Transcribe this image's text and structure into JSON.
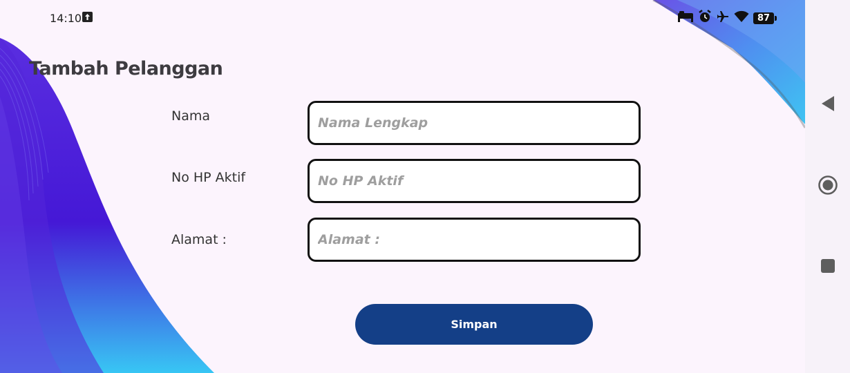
{
  "status_bar": {
    "time": "14:10",
    "upload_icon": "upload-arrow-icon",
    "icons": [
      "bed-icon",
      "alarm-icon",
      "airplane-icon",
      "wifi-icon"
    ],
    "battery_level": "87"
  },
  "page": {
    "title": "Tambah Pelanggan"
  },
  "form": {
    "fields": [
      {
        "label": "Nama",
        "value": "",
        "placeholder": "Nama Lengkap"
      },
      {
        "label": "No HP Aktif",
        "value": "",
        "placeholder": "No HP Aktif"
      },
      {
        "label": "Alamat :",
        "value": "",
        "placeholder": "Alamat :"
      }
    ],
    "submit_label": "Simpan"
  },
  "colors": {
    "background": "#fcf4fd",
    "primary_button": "#143f87",
    "wave_purple": "#4a1fd8",
    "wave_cyan": "#3ec7f5"
  },
  "nav_bar": {
    "icons": [
      "back-icon",
      "home-icon",
      "recents-icon"
    ]
  }
}
